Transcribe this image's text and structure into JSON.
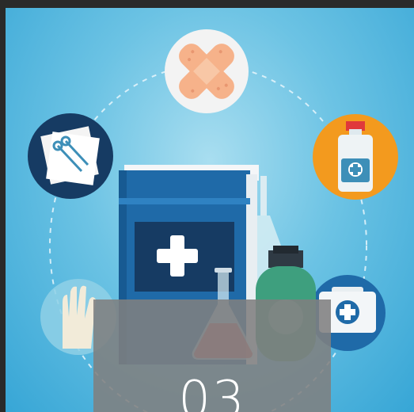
{
  "card": {
    "number": "03",
    "icons": [
      "bandage-icon",
      "gauze-pins-icon",
      "medicine-bottle-icon",
      "gloves-icon",
      "first-aid-kit-icon",
      "medical-book-icon",
      "flask-icon",
      "bottle-icon"
    ]
  },
  "colors": {
    "background": "#37a6d6",
    "book": "#1f6aa8",
    "overlay": "#808080",
    "orange": "#f39a1e",
    "navy": "#163b63"
  }
}
